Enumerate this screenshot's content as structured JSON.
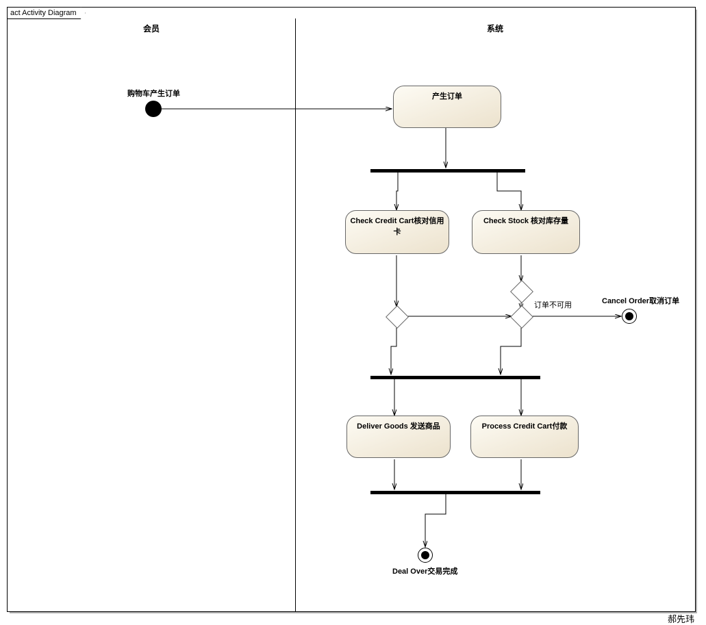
{
  "tab": "act Activity Diagram",
  "swimlanes": {
    "left": "会员",
    "right": "系统"
  },
  "labels": {
    "startLabel": "购物车产生订单",
    "cancelLabel": "Cancel Order取消订单",
    "dealOverLabel": "Deal Over交易完成",
    "unavailable": "订单不可用"
  },
  "activities": {
    "generate": "产生订单",
    "checkCredit": "Check Credit Cart核对信用卡",
    "checkStock": "Check Stock 核对库存量",
    "deliver": "Deliver Goods 发送商品",
    "process": "Process Credit Cart付款"
  },
  "signature": "郝先玮"
}
